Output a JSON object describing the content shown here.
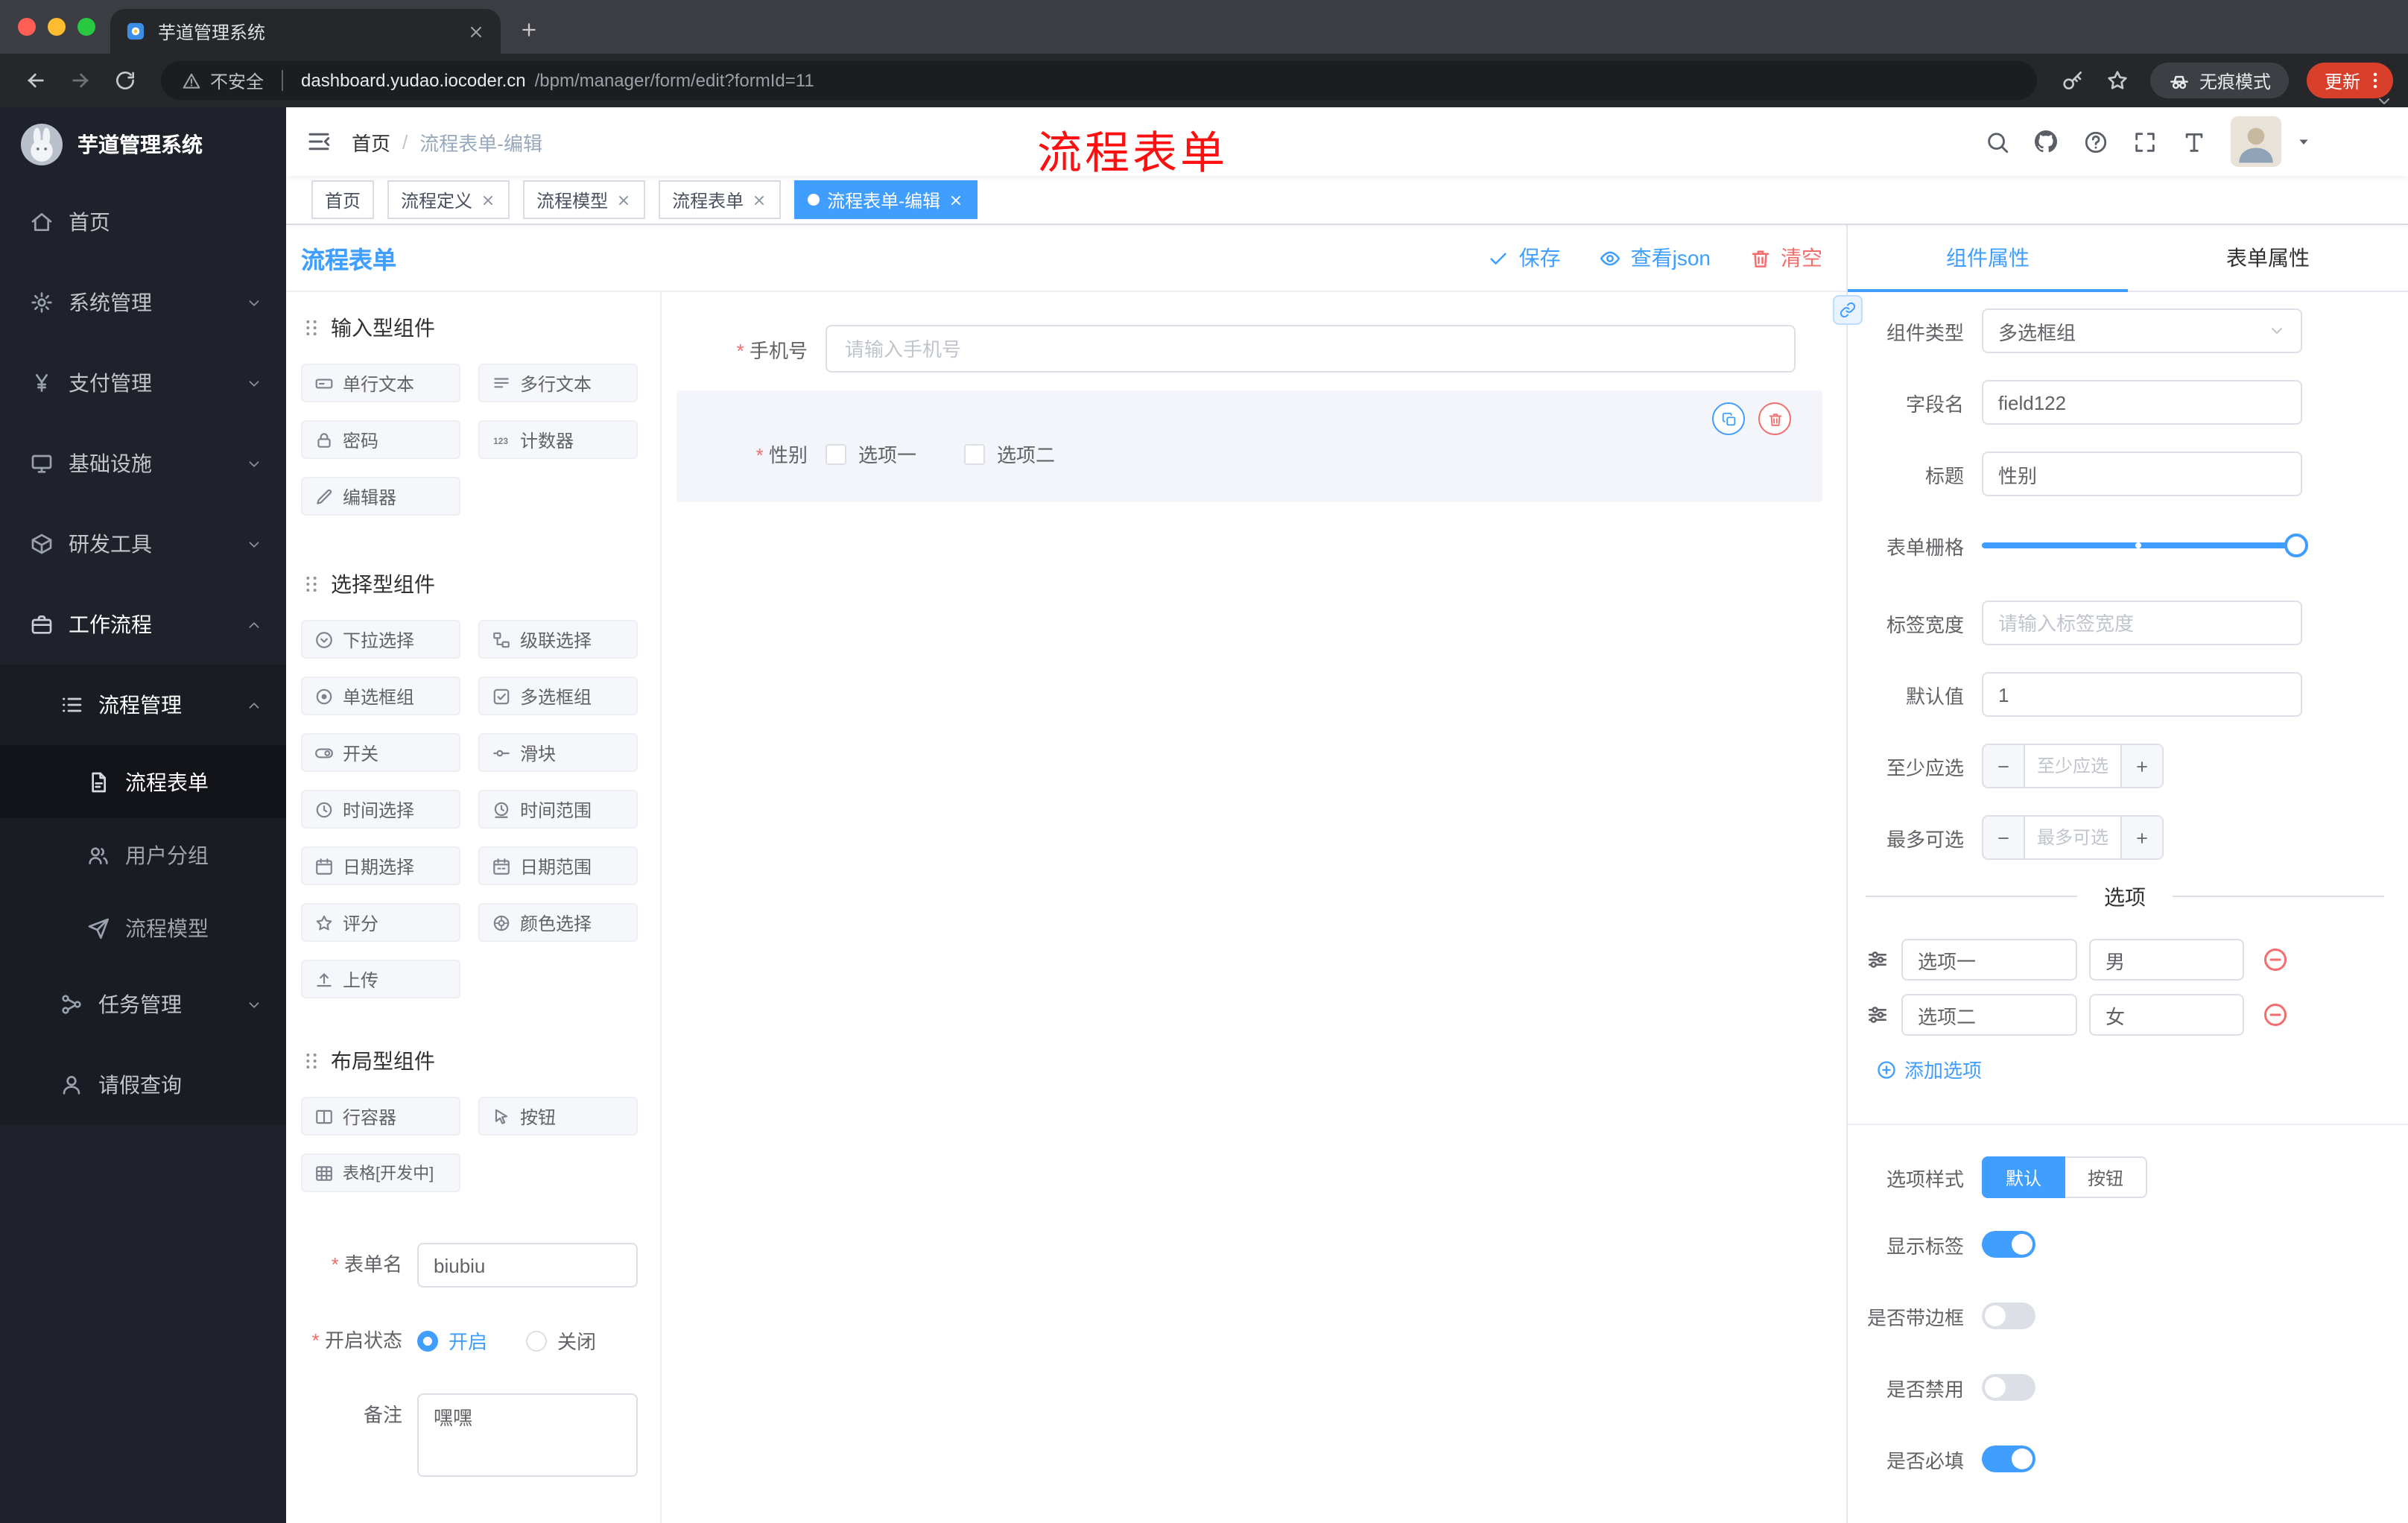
{
  "browser": {
    "tab_title": "芋道管理系统",
    "security_label": "不安全",
    "url_domain": "dashboard.yudao.iocoder.cn",
    "url_path": "/bpm/manager/form/edit?formId=11",
    "incognito_label": "无痕模式",
    "update_label": "更新"
  },
  "sidebar": {
    "logo_title": "芋道管理系统",
    "items": [
      {
        "label": "首页",
        "icon": "home"
      },
      {
        "label": "系统管理",
        "icon": "gear",
        "chevron": "down"
      },
      {
        "label": "支付管理",
        "icon": "yen",
        "chevron": "down"
      },
      {
        "label": "基础设施",
        "icon": "monitor",
        "chevron": "down"
      },
      {
        "label": "研发工具",
        "icon": "cube",
        "chevron": "down"
      },
      {
        "label": "工作流程",
        "icon": "briefcase",
        "chevron": "up",
        "expanded": true
      },
      {
        "label": "流程管理",
        "icon": "list",
        "chevron": "up",
        "expanded": true
      },
      {
        "label": "流程表单",
        "icon": "doc",
        "active": true
      },
      {
        "label": "用户分组",
        "icon": "users"
      },
      {
        "label": "流程模型",
        "icon": "send"
      },
      {
        "label": "任务管理",
        "icon": "branch",
        "chevron": "down"
      },
      {
        "label": "请假查询",
        "icon": "user"
      }
    ]
  },
  "header": {
    "breadcrumb_home": "首页",
    "breadcrumb_sep": "/",
    "breadcrumb_current": "流程表单-编辑",
    "annotation": "流程表单"
  },
  "tags": [
    {
      "label": "首页",
      "closable": false,
      "active": false
    },
    {
      "label": "流程定义",
      "closable": true,
      "active": false
    },
    {
      "label": "流程模型",
      "closable": true,
      "active": false
    },
    {
      "label": "流程表单",
      "closable": true,
      "active": false
    },
    {
      "label": "流程表单-编辑",
      "closable": true,
      "active": true
    }
  ],
  "designer": {
    "title": "流程表单",
    "save_label": "保存",
    "view_json_label": "查看json",
    "clear_label": "清空"
  },
  "palette": {
    "sections": [
      {
        "title": "输入型组件",
        "items": [
          {
            "label": "单行文本",
            "icon": "input"
          },
          {
            "label": "多行文本",
            "icon": "lines"
          },
          {
            "label": "密码",
            "icon": "lock"
          },
          {
            "label": "计数器",
            "icon": "counter"
          },
          {
            "label": "编辑器",
            "icon": "edit"
          }
        ]
      },
      {
        "title": "选择型组件",
        "items": [
          {
            "label": "下拉选择",
            "icon": "select"
          },
          {
            "label": "级联选择",
            "icon": "cascade"
          },
          {
            "label": "单选框组",
            "icon": "radio"
          },
          {
            "label": "多选框组",
            "icon": "checkbox"
          },
          {
            "label": "开关",
            "icon": "switch"
          },
          {
            "label": "滑块",
            "icon": "slider"
          },
          {
            "label": "时间选择",
            "icon": "time"
          },
          {
            "label": "时间范围",
            "icon": "time-range"
          },
          {
            "label": "日期选择",
            "icon": "date"
          },
          {
            "label": "日期范围",
            "icon": "date-range"
          },
          {
            "label": "评分",
            "icon": "star"
          },
          {
            "label": "颜色选择",
            "icon": "color"
          },
          {
            "label": "上传",
            "icon": "upload"
          }
        ]
      },
      {
        "title": "布局型组件",
        "items": [
          {
            "label": "行容器",
            "icon": "row"
          },
          {
            "label": "按钮",
            "icon": "button"
          },
          {
            "label": "表格[开发中]",
            "icon": "table"
          }
        ]
      }
    ],
    "form": {
      "name_label": "表单名",
      "name_value": "biubiu",
      "status_label": "开启状态",
      "status_on": "开启",
      "status_off": "关闭",
      "remark_label": "备注",
      "remark_value": "嘿嘿"
    }
  },
  "canvas": {
    "phone_label": "手机号",
    "phone_placeholder": "请输入手机号",
    "gender_label": "性别",
    "gender_options": [
      "选项一",
      "选项二"
    ]
  },
  "props": {
    "tab_component": "组件属性",
    "tab_form": "表单属性",
    "component_type_label": "组件类型",
    "component_type_value": "多选框组",
    "field_label": "字段名",
    "field_value": "field122",
    "title_label": "标题",
    "title_value": "性别",
    "grid_label": "表单栅格",
    "label_width_label": "标签宽度",
    "label_width_placeholder": "请输入标签宽度",
    "default_label": "默认值",
    "default_value": "1",
    "min_label": "至少应选",
    "min_placeholder": "至少应选",
    "max_label": "最多可选",
    "max_placeholder": "最多可选",
    "options_divider": "选项",
    "options": [
      {
        "name": "选项一",
        "value": "男"
      },
      {
        "name": "选项二",
        "value": "女"
      }
    ],
    "add_option_label": "添加选项",
    "style_label": "选项样式",
    "style_default": "默认",
    "style_button": "按钮",
    "toggles": [
      {
        "label": "显示标签",
        "on": true
      },
      {
        "label": "是否带边框",
        "on": false
      },
      {
        "label": "是否禁用",
        "on": false
      },
      {
        "label": "是否必填",
        "on": true
      }
    ]
  },
  "colors": {
    "accent": "#409eff",
    "danger": "#f56c6c",
    "annotation": "#ff0000"
  }
}
